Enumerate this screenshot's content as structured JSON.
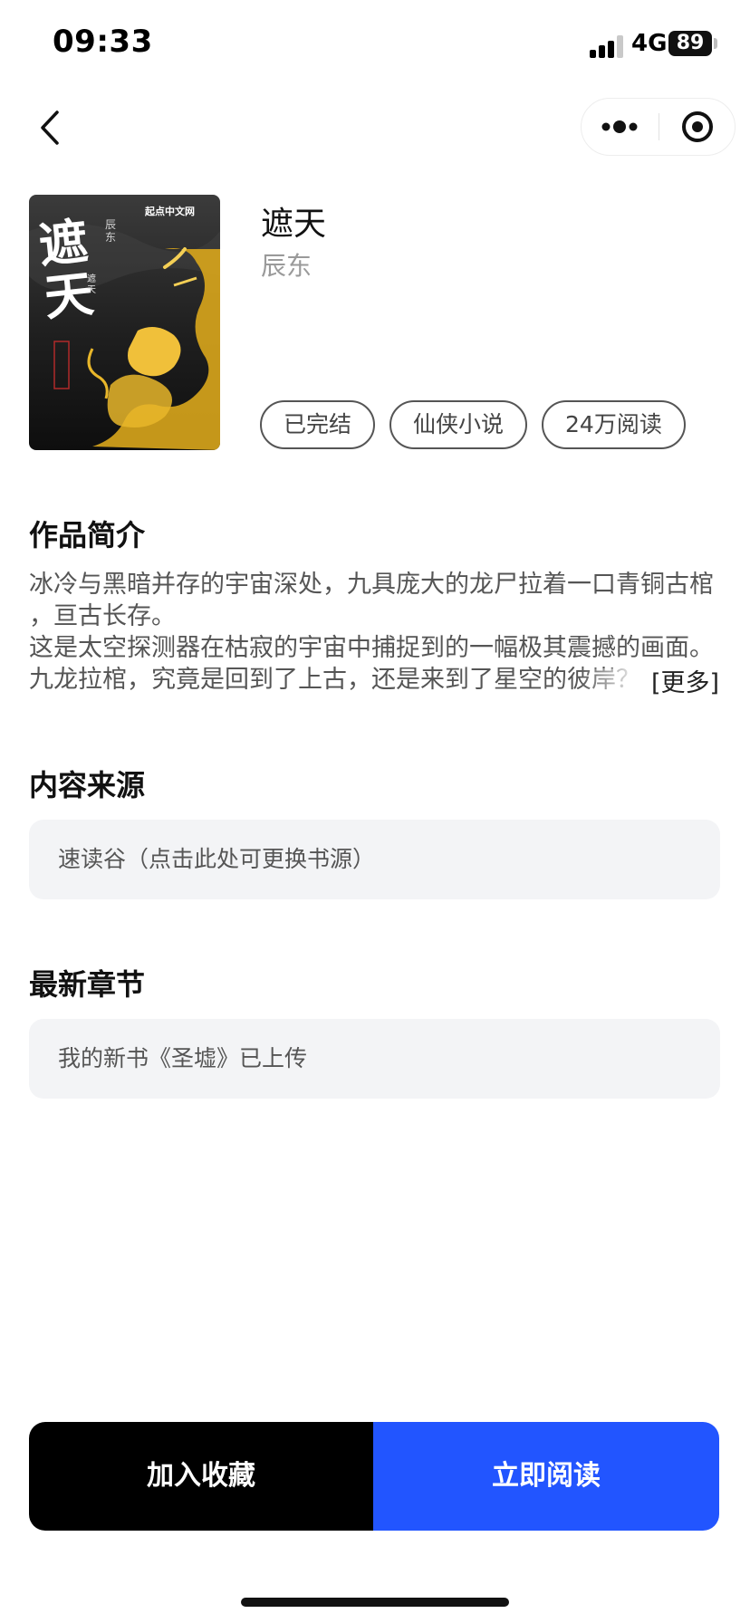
{
  "status_bar": {
    "time": "09:33",
    "network": "4G",
    "battery": "89",
    "icons": [
      "signal-icon",
      "battery-icon"
    ]
  },
  "nav": {
    "back_icon": "chevron-left-icon",
    "more_icon": "more-dots-icon",
    "close_icon": "target-circle-icon"
  },
  "book": {
    "title": "遮天",
    "author": "辰东",
    "cover": {
      "publisher": "起点中文网",
      "calligraphy": "遮天",
      "author": "辰东",
      "small_title": "遮天",
      "accent_color": "#e8b62a"
    },
    "tags": [
      "已完结",
      "仙侠小说",
      "24万阅读"
    ]
  },
  "intro": {
    "heading": "作品简介",
    "lines": [
      "冰冷与黑暗并存的宇宙深处，九具庞大的龙尸拉着一口青铜古棺",
      "，亘古长存。",
      "这是太空探测器在枯寂的宇宙中捕捉到的一幅极其震撼的画面。",
      "九龙拉棺，究竟是回到了上古，还是来到了星空的彼岸？"
    ],
    "more_label": "[更多]"
  },
  "source": {
    "heading": "内容来源",
    "value": "速读谷（点击此处可更换书源）"
  },
  "latest": {
    "heading": "最新章节",
    "value": "我的新书《圣墟》已上传"
  },
  "actions": {
    "collect_label": "加入收藏",
    "read_label": "立即阅读",
    "read_color": "#2255ff"
  }
}
